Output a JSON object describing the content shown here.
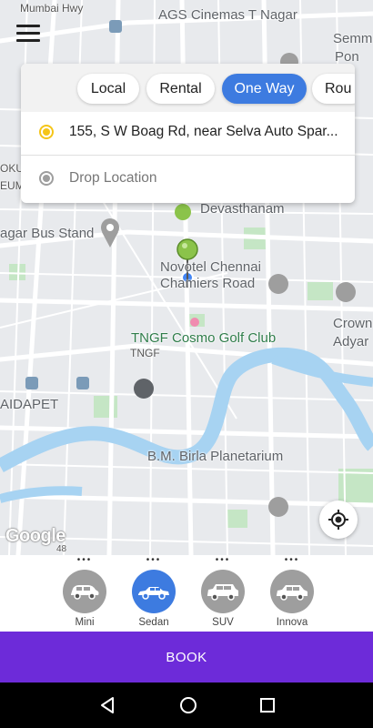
{
  "map": {
    "labels": {
      "mumbai_hwy": "Mumbai Hwy",
      "ags_cinemas": "AGS Cinemas T Nagar",
      "semm": "Semm",
      "pon": "Pon",
      "okul": "OKU",
      "eum": "EUM",
      "devasthanam": "Devasthanam",
      "bus_stand": "agar Bus Stand",
      "novotel_1": "Novotel Chennai",
      "novotel_2": "Chamiers Road",
      "tngf_cosmo": "TNGF Cosmo Golf Club",
      "tngf": "TNGF",
      "crown": "Crown",
      "adyar": "Adyar",
      "aidapet": "AIDAPET",
      "bm_birla": "B.M. Birla Planetarium",
      "road_48": "48"
    },
    "google_logo": "Google"
  },
  "menu_icon": "hamburger-menu-icon",
  "trip_tabs": [
    {
      "label": "Local",
      "active": false
    },
    {
      "label": "Rental",
      "active": false
    },
    {
      "label": "One Way",
      "active": true
    },
    {
      "label": "Rou",
      "active": false
    }
  ],
  "pickup": {
    "value": "155, S W Boag Rd, near Selva Auto Spar...",
    "icon": "pickup-dot-icon",
    "color": "#f5c518"
  },
  "drop": {
    "placeholder": "Drop Location",
    "icon": "drop-dot-icon",
    "color": "#9e9e9e"
  },
  "locate_icon": "my-location-icon",
  "car_types": [
    {
      "name": "Mini",
      "selected": false,
      "icon": "hatchback-car-icon"
    },
    {
      "name": "Sedan",
      "selected": true,
      "icon": "sedan-car-icon"
    },
    {
      "name": "SUV",
      "selected": false,
      "icon": "suv-car-icon"
    },
    {
      "name": "Innova",
      "selected": false,
      "icon": "mpv-car-icon"
    }
  ],
  "book_label": "BOOK",
  "colors": {
    "accent": "#3d7be0",
    "book": "#6d2bd9",
    "pin": "#8bc34a"
  },
  "nav": {
    "back_icon": "back-triangle-icon",
    "home_icon": "home-circle-icon",
    "recents_icon": "recents-square-icon"
  }
}
